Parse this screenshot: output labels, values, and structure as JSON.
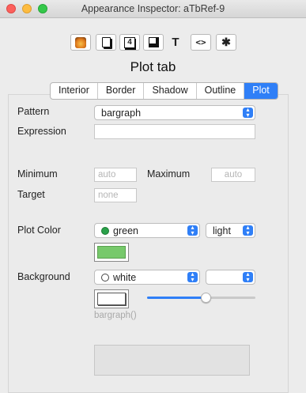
{
  "window": {
    "title": "Appearance Inspector: aTbRef-9"
  },
  "toolbar": {
    "buttons": [
      {
        "name": "app-icon-tool-button",
        "glyph": ""
      },
      {
        "name": "document-tool-button",
        "glyph": ""
      },
      {
        "name": "number-tool-button",
        "glyph": "4"
      },
      {
        "name": "border-tool-button",
        "glyph": ""
      },
      {
        "name": "text-tool-button",
        "glyph": "T"
      },
      {
        "name": "code-tool-button",
        "glyph": "<>"
      },
      {
        "name": "gear-tool-button",
        "glyph": "✱"
      }
    ],
    "selected_name": "Plot tab"
  },
  "tabs": [
    "Interior",
    "Border",
    "Shadow",
    "Outline",
    "Plot"
  ],
  "selected_tab": "Plot",
  "form": {
    "pattern_label": "Pattern",
    "pattern_value": "bargraph",
    "expression_label": "Expression",
    "expression_value": "",
    "minimum_label": "Minimum",
    "minimum_placeholder": "auto",
    "maximum_label": "Maximum",
    "maximum_placeholder": "auto",
    "target_label": "Target",
    "target_placeholder": "none",
    "plot_color_label": "Plot Color",
    "plot_color_value": "green",
    "plot_color_shade": "light",
    "background_label": "Background",
    "background_value": "white",
    "background_shade": "",
    "preview_text": "bargraph()",
    "opacity_level": 0.55
  },
  "colors": {
    "accent": "#2f7ff7",
    "green": "#2aa14a",
    "green_swatch": "#77c96b",
    "close": "#fc605c",
    "minimize": "#fdbc40",
    "zoom": "#34c84a"
  }
}
